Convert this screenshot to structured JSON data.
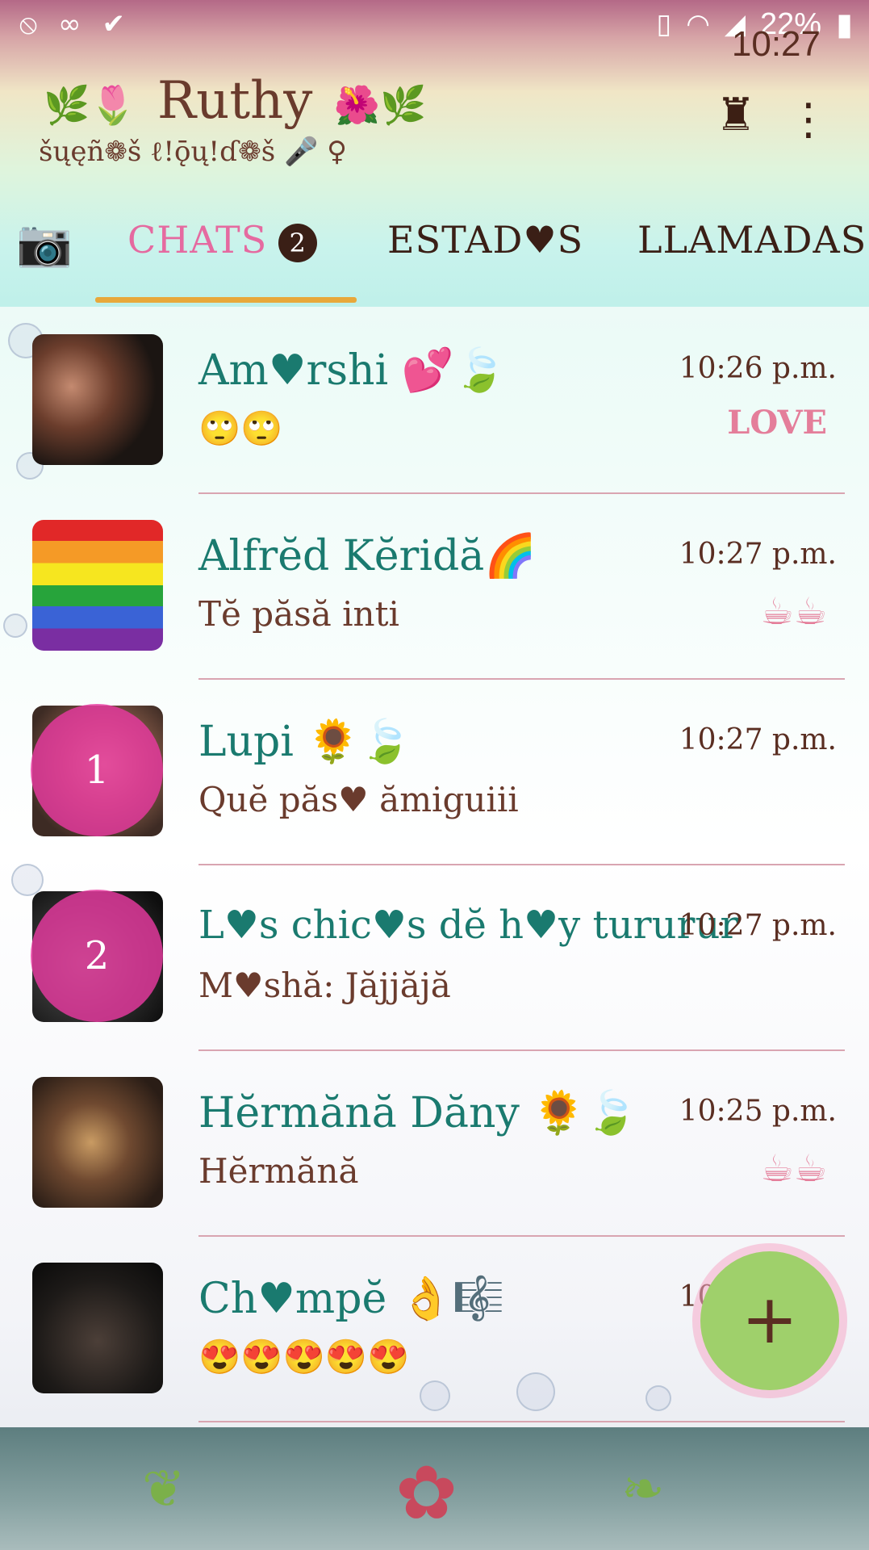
{
  "statusbar": {
    "left_icons": [
      "wifi-off-icon",
      "voicemail-icon",
      "check-icon"
    ],
    "battery": "22%",
    "time": "10:27"
  },
  "header": {
    "title": "Ruthy",
    "subtitle": "šųęñ❁š ℓ!ǭų!ɗ❁š 🎤     ♀",
    "deco_left": "🌿🌷",
    "deco_right": "🌺🌿"
  },
  "tabs": [
    {
      "label": "CHATS",
      "badge": "2"
    },
    {
      "label": "ESTAD♥S"
    },
    {
      "label": "LLAMADAS"
    }
  ],
  "chats": [
    {
      "name": "Am♥rshi 💕🍃",
      "message": "🙄🙄",
      "time": "10:26 p.m.",
      "meta_icon": "LOVE"
    },
    {
      "name": "Alfrĕd Kĕridă🌈",
      "message": "Tĕ păsă inti",
      "time": "10:27 p.m.",
      "meta_icon": "☕☕"
    },
    {
      "name": "Lupi 🌻🍃",
      "message": "Quĕ păs♥ ămiguiii",
      "time": "10:27 p.m.",
      "status_count": "1"
    },
    {
      "name": "L♥s chic♥s dĕ h♥y tururur",
      "message": "M♥shă: Jăjjăjă",
      "time": "10:27 p.m.",
      "status_count": "2"
    },
    {
      "name": "Hĕrmănă Dăny 🌻🍃",
      "message": "Hĕrmănă",
      "time": "10:25 p.m.",
      "meta_icon": "☕☕"
    },
    {
      "name": "Ch♥mpĕ 👌🎼",
      "message": "😍😍😍😍😍",
      "time": "10:21 p.m."
    }
  ],
  "fab": {
    "label": "+"
  }
}
